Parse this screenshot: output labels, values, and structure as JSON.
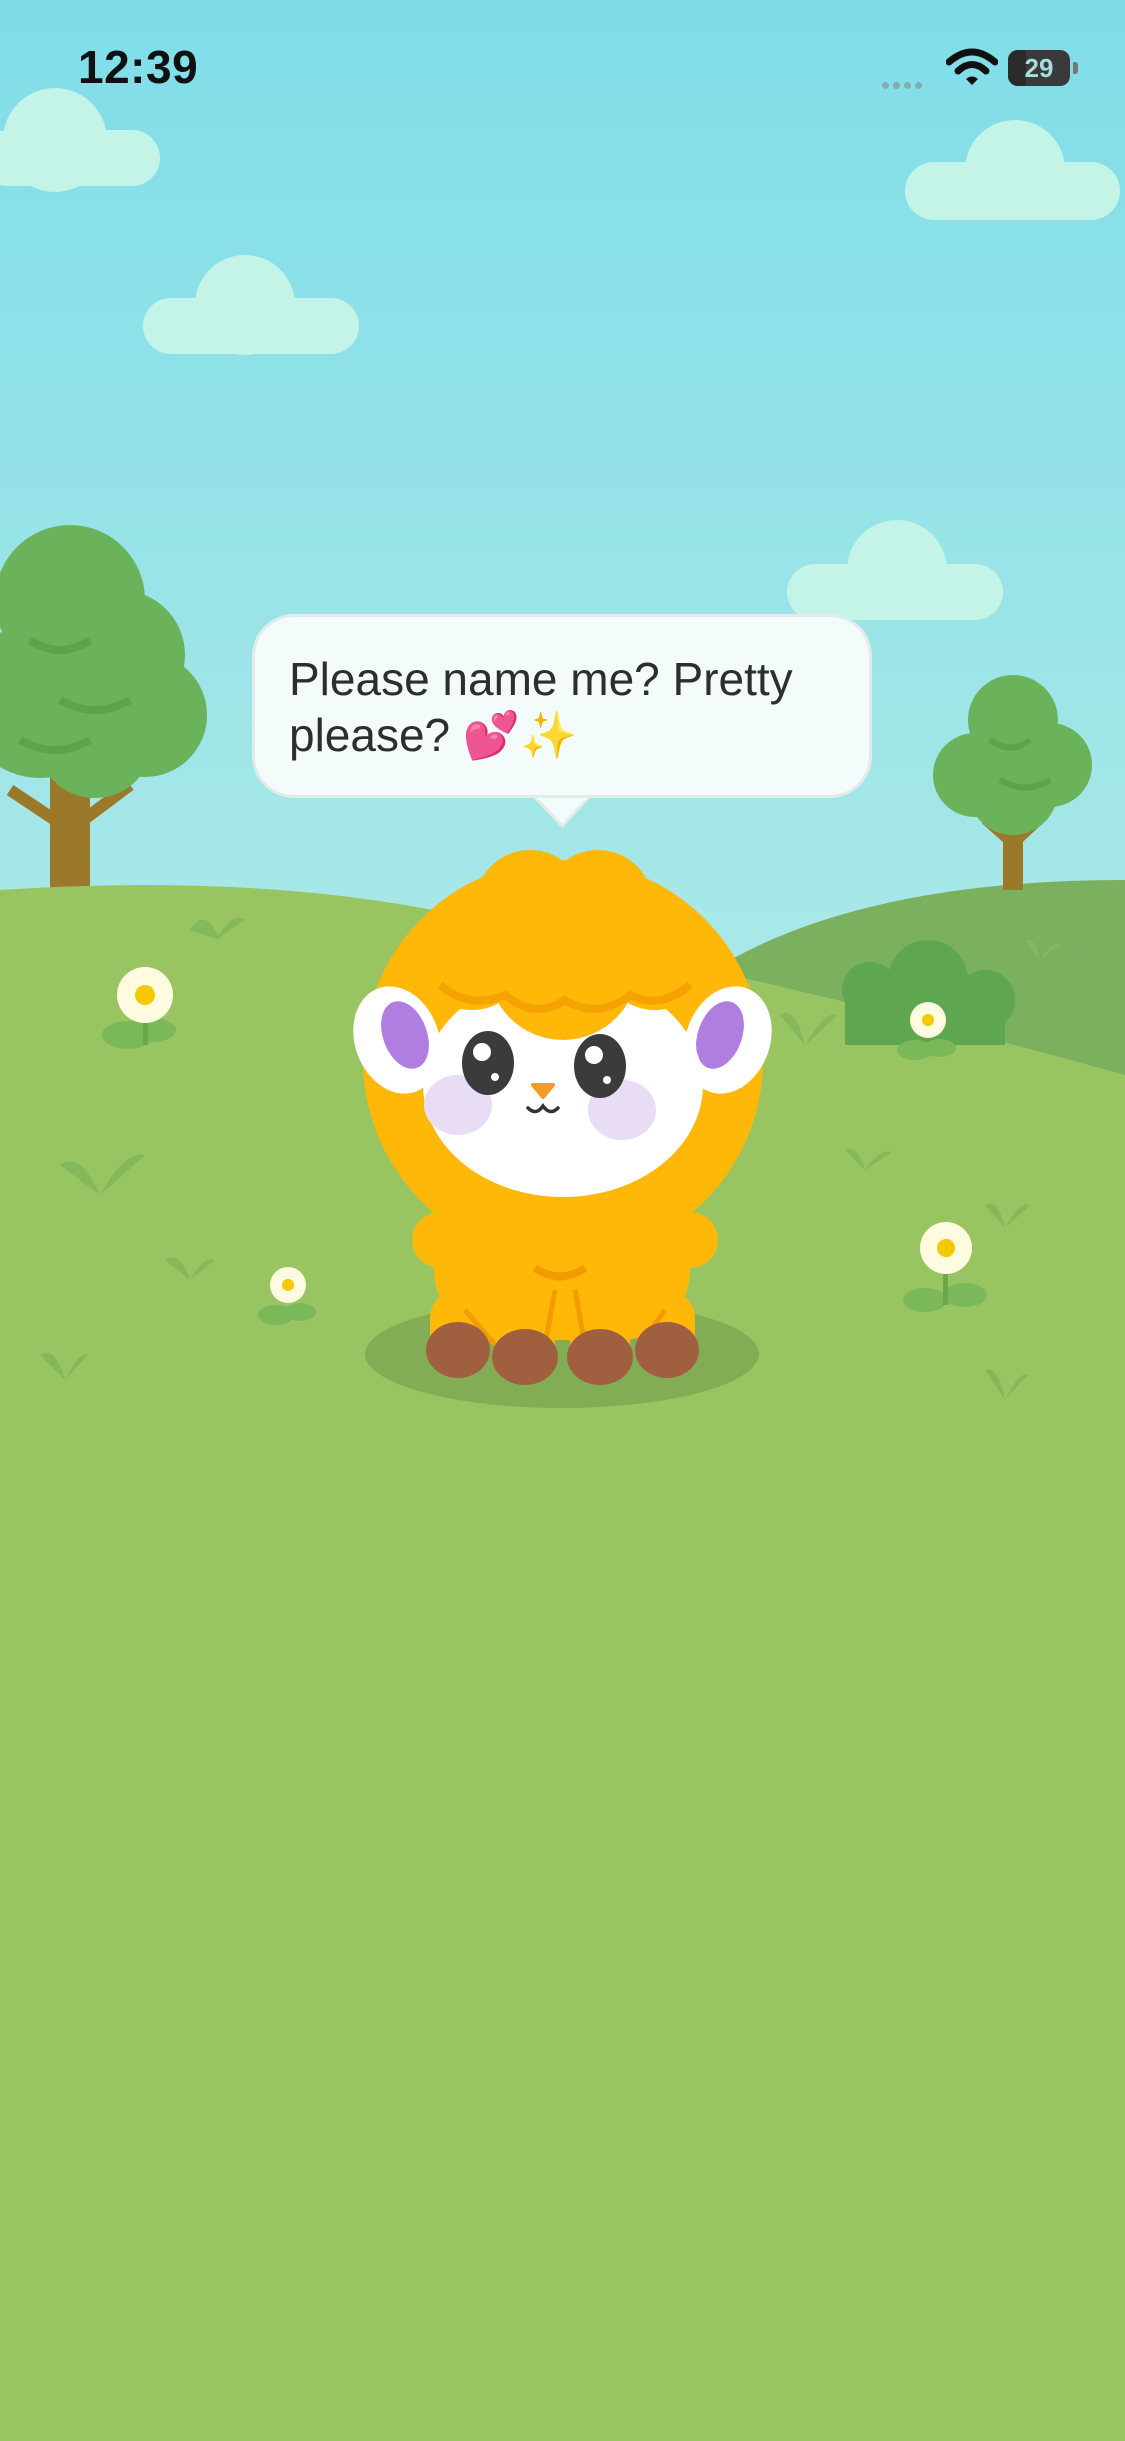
{
  "status_bar": {
    "time": "12:39",
    "battery_level": "29",
    "battery_percent": 29,
    "signal_icon": "cellular-signal-dots",
    "wifi_icon": "wifi-icon",
    "battery_icon": "battery-icon"
  },
  "speech_bubble": {
    "text": "Please name me? Pretty please? 💕✨"
  },
  "colors": {
    "sky_top": "#7fdde8",
    "sky_bottom": "#a9e8e8",
    "grass": "#98c562",
    "hill_dark": "#7ab05e",
    "sheep_wool": "#ffb808",
    "sheep_face": "#ffffff",
    "sheep_ears": "#b07ee0",
    "sheep_hooves": "#a0603f",
    "cloud": "#c4f3e8",
    "tree_leaves": "#6bb35a",
    "tree_trunk": "#9a7a2a"
  },
  "icons": {
    "sheep": "sheep-mascot-icon",
    "tree": "tree-icon",
    "cloud": "cloud-icon",
    "flower": "daisy-flower-icon",
    "bush": "bush-icon"
  }
}
